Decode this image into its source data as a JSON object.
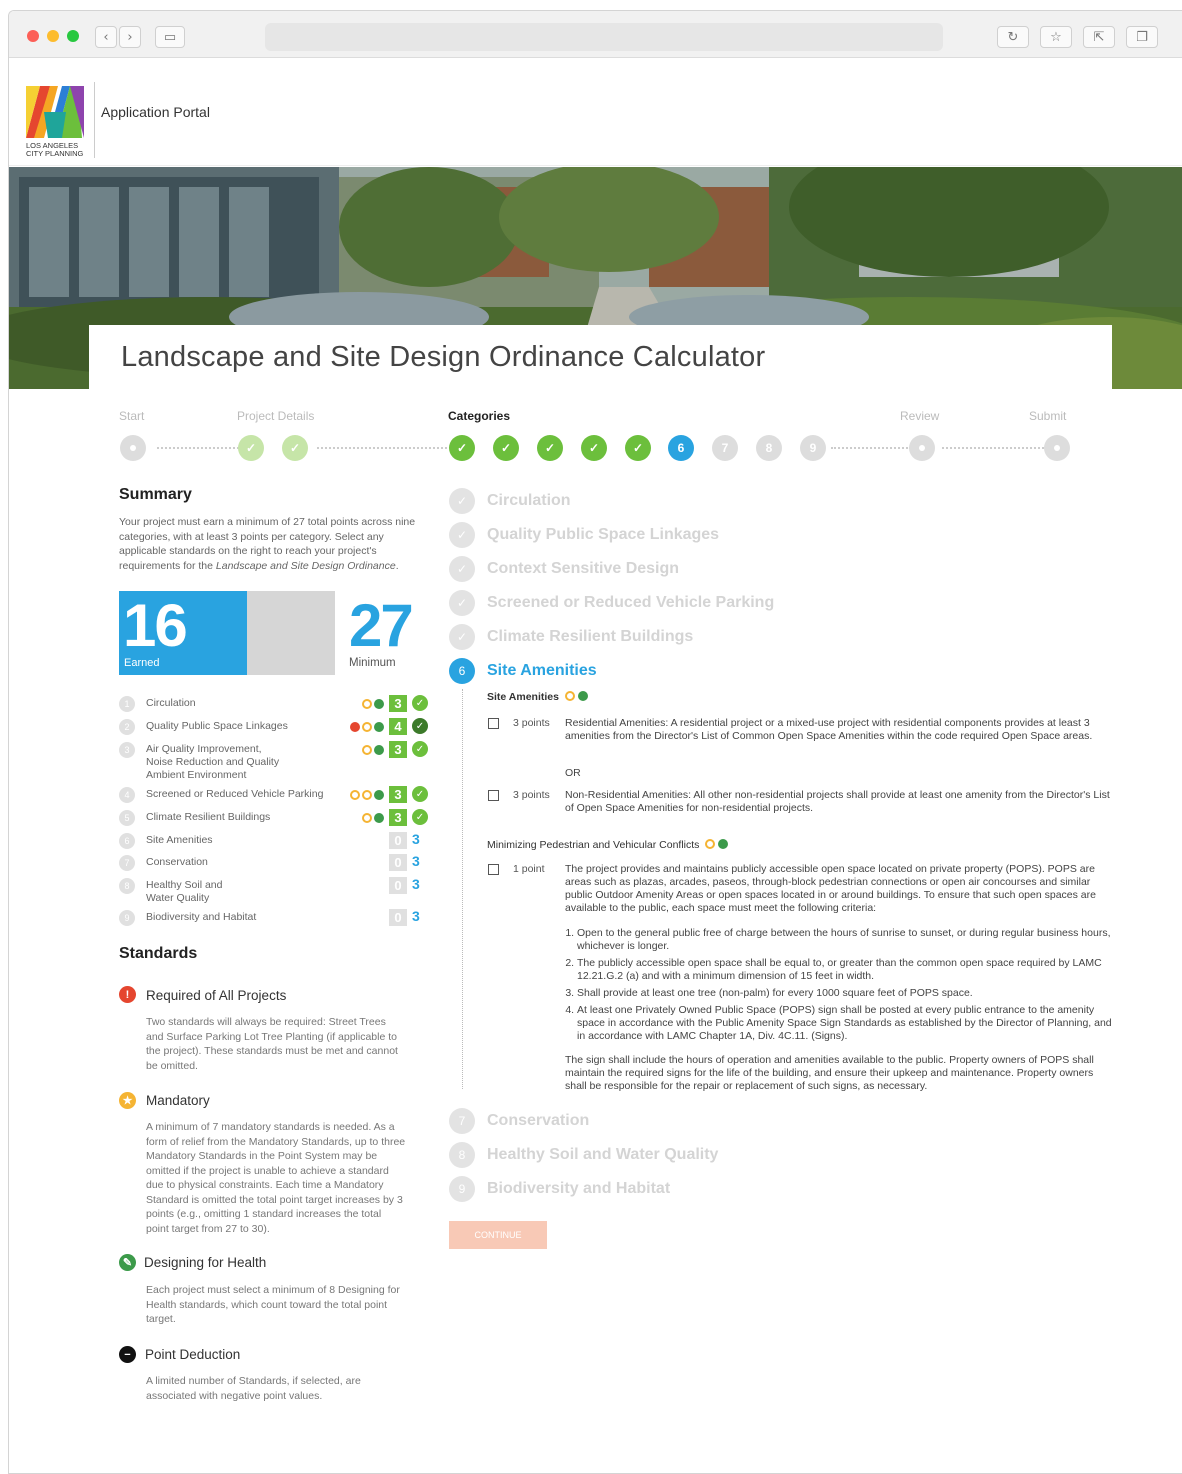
{
  "portal_title": "Application Portal",
  "logo": {
    "line1": "LOS ANGELES",
    "line2": "CITY PLANNING"
  },
  "page_title": "Landscape and Site Design Ordinance Calculator",
  "steps": {
    "start": "Start",
    "project_details": "Project Details",
    "categories": "Categories",
    "review": "Review",
    "submit": "Submit",
    "category_numbers": [
      "1",
      "2",
      "3",
      "4",
      "5",
      "6",
      "7",
      "8",
      "9"
    ]
  },
  "summary": {
    "heading": "Summary",
    "intro_pre": "Your project must earn a minimum of 27 total points across nine categories, with at least 3 points per category. Select any applicable standards on the right to reach your project's requirements for the ",
    "intro_em": "Landscape and Site Design Ordinance",
    "intro_post": ".",
    "earned_value": "16",
    "earned_label": "Earned",
    "minimum_value": "27",
    "minimum_label": "Minimum",
    "earned_fraction": 0.5926
  },
  "summary_categories": [
    {
      "num": "1",
      "name": "Circulation",
      "score": "3",
      "status": "done"
    },
    {
      "num": "2",
      "name": "Quality Public Space Linkages",
      "score": "4",
      "status": "done"
    },
    {
      "num": "3",
      "name": "Air Quality Improvement, Noise Reduction and Quality Ambient Environment",
      "score": "3",
      "status": "done"
    },
    {
      "num": "4",
      "name": "Screened or Reduced Vehicle Parking",
      "score": "3",
      "status": "done"
    },
    {
      "num": "5",
      "name": "Climate Resilient Buildings",
      "score": "3",
      "status": "done"
    },
    {
      "num": "6",
      "name": "Site Amenities",
      "score": "0",
      "target": "3",
      "status": "todo"
    },
    {
      "num": "7",
      "name": "Conservation",
      "score": "0",
      "target": "3",
      "status": "todo"
    },
    {
      "num": "8",
      "name": "Healthy Soil and Water Quality",
      "score": "0",
      "target": "3",
      "status": "todo"
    },
    {
      "num": "9",
      "name": "Biodiversity and Habitat",
      "score": "0",
      "target": "3",
      "status": "todo"
    }
  ],
  "standards": {
    "heading": "Standards",
    "items": [
      {
        "title": "Required of All Projects",
        "text": "Two standards will always be required: Street Trees and Surface Parking Lot Tree Planting (if applicable to the project). These standards must be met and cannot be omitted."
      },
      {
        "title": "Mandatory",
        "text": "A minimum of 7 mandatory standards is needed. As a form of relief from the Mandatory Standards, up to three Mandatory Standards in the Point System may be omitted if the project is unable to achieve a standard due to physical constraints. Each time a Mandatory Standard is omitted the total point target increases by 3 points (e.g., omitting 1 standard increases the total point target from 27 to 30)."
      },
      {
        "title": "Designing for Health",
        "text": "Each project must select a minimum of 8 Designing for Health standards, which count toward the total point target."
      },
      {
        "title": "Point Deduction",
        "text": "A limited number of Standards, if selected, are associated with negative point values."
      }
    ]
  },
  "categories_right": {
    "done": [
      "Circulation",
      "Quality Public Space Linkages",
      "Context Sensitive Design",
      "Screened or Reduced Vehicle Parking",
      "Climate Resilient Buildings"
    ],
    "active": {
      "num": "6",
      "name": "Site Amenities"
    },
    "pending": [
      {
        "num": "7",
        "name": "Conservation"
      },
      {
        "num": "8",
        "name": "Healthy Soil and Water Quality"
      },
      {
        "num": "9",
        "name": "Biodiversity and Habitat"
      }
    ]
  },
  "site_amenities": {
    "group1_title": "Site Amenities",
    "opt1_points": "3 points",
    "opt1_text": "Residential Amenities: A residential project or a mixed-use project with residential components provides at least 3 amenities from the Director's List of Common Open Space Amenities within the code required Open Space areas.",
    "or": "OR",
    "opt2_points": "3 points",
    "opt2_text": "Non-Residential Amenities: All other non-residential projects shall provide at least one amenity from the Director's List of Open Space Amenities for non-residential projects.",
    "group2_title": "Minimizing Pedestrian and Vehicular Conflicts",
    "opt3_points": "1 point",
    "opt3_text": "The project provides and maintains publicly accessible open space located on private property (POPS). POPS are areas such as plazas, arcades, paseos, through-block pedestrian connections or open air concourses and similar public Outdoor Amenity Areas or open spaces located in or around buildings. To ensure that such open spaces are available to the public, each space must meet the following criteria:",
    "criteria": [
      "Open to the general public free of charge between the hours of sunrise to sunset, or during regular business hours, whichever is longer.",
      "The publicly accessible open space shall be equal to, or greater than the common open space required by LAMC 12.21.G.2 (a) and with a minimum dimension of 15 feet in width.",
      "Shall provide at least one tree (non-palm) for every 1000 square feet of POPS space.",
      "At least one Privately Owned Public Space (POPS) sign shall be posted at every public entrance to the amenity space in accordance with the Public Amenity Space Sign Standards as established by the Director of Planning, and in accordance with LAMC Chapter 1A, Div. 4C.11. (Signs)."
    ],
    "closing": "The sign shall include the hours of operation and amenities available to the public. Property owners of POPS shall maintain the required signs for the life of the building, and ensure their upkeep and maintenance. Property owners shall be responsible for the repair or replacement of such signs, as necessary."
  },
  "continue_label": "CONTINUE",
  "colors": {
    "blue": "#29a3e0",
    "green": "#6cbf3c",
    "dark_green": "#3c7a2a",
    "orange": "#f5b433",
    "red": "#e5462f",
    "grey": "#d6d6d6",
    "button": "#f8c9b6"
  }
}
